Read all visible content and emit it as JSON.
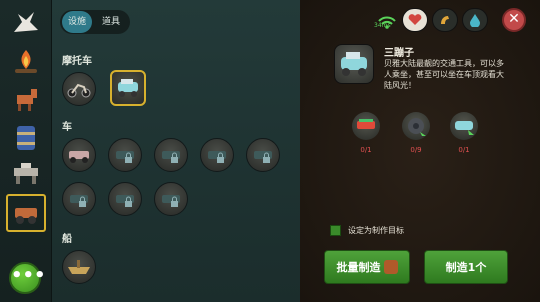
{
  "tabs": {
    "active": "设施",
    "other": "道具"
  },
  "sections": {
    "motorcycle": "摩托车",
    "car": "车",
    "boat": "船"
  },
  "status": {
    "ping": "34ms"
  },
  "item": {
    "title": "三蹦子",
    "description": "贝雅大陆最靓的交通工具，可以多人乘坐，甚至可以坐在车顶观看大陆风光！"
  },
  "materials": [
    {
      "icon": "skate-part-icon",
      "count": "0/1"
    },
    {
      "icon": "gear-part-icon",
      "count": "0/9"
    },
    {
      "icon": "tricycle-part-icon",
      "count": "0/1"
    }
  ],
  "craft_target_label": "设定为制作目标",
  "buttons": {
    "batch": "批量制造",
    "craft": "制造1个"
  },
  "colors": {
    "accent": "#d7b12e",
    "green": "#3e8f2a",
    "red": "#e05050"
  }
}
